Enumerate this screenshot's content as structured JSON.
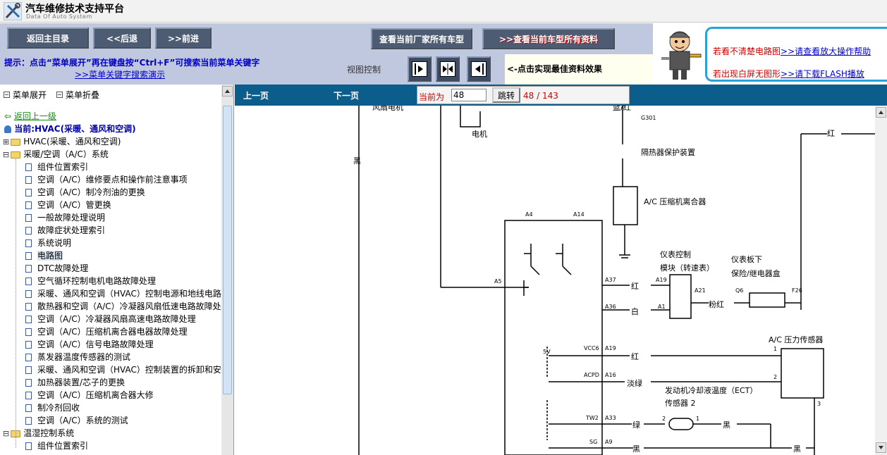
{
  "app": {
    "title": "汽车维修技术支持平台",
    "subtitle": "Data Of Auto System"
  },
  "nav": {
    "home": "返回主目录",
    "back": "<<后退",
    "forward": ">>前进",
    "all_models": "查看当前厂家所有车型",
    "all_data": ">>查看当前车型所有资料"
  },
  "hint": {
    "text": "提示：点击“菜单展开”再在键盘按“Ctrl+F”可搜索当前菜单关键字",
    "link": ">>菜单关键字搜索演示"
  },
  "view_control": {
    "label": "视图控制",
    "best_effect": "<-点击实现最佳资料效果"
  },
  "help": {
    "line1_text": "若看不清楚电路图",
    "line1_link": ">>请查看放大操作帮助",
    "line2_text": "若出现白屏无图形",
    "line2_link": ">>请下载FLASH播放"
  },
  "menu": {
    "expand": "菜单展开",
    "collapse": "菜单折叠"
  },
  "tree": {
    "back_up": "返回上一级",
    "current": "当前:HVAC(采暖、通风和空调)",
    "items": [
      "HVAC(采暖、通风和空调)",
      "采暖/空调（A/C）系统",
      "组件位置索引",
      "空调（A/C）维修要点和操作前注意事项",
      "空调（A/C）制冷剂油的更换",
      "空调（A/C）管更换",
      "一般故障处理说明",
      "故障症状处理索引",
      "系统说明",
      "电路图",
      "DTC故障处理",
      "空气循环控制电机电路故障处理",
      "采暖、通风和空调（HVAC）控制电源和地线电路",
      "散热器和空调（A/C）冷凝器风扇低速电路故障处",
      "空调（A/C）冷凝器风扇高速电路故障处理",
      "空调（A/C）压缩机离合器电器故障处理",
      "空调（A/C）信号电路故障处理",
      "蒸发器温度传感器的测试",
      "采暖、通风和空调（HVAC）控制装置的拆卸和安",
      "加热器装置/芯子的更换",
      "空调（A/C）压缩机离合器大修",
      "制冷剂回收",
      "空调（A/C）系统的测试",
      "温湿控制系统",
      "组件位置索引"
    ]
  },
  "pager": {
    "prev": "上一页",
    "next": "下一页",
    "current_label": "当前为",
    "current_value": "48",
    "jump": "跳转",
    "count": "48 / 143"
  },
  "diagram": {
    "top_left_label": "风扇电机",
    "motor_label": "电机",
    "black1": "黑",
    "blue_red": "蓝/红",
    "g301": "G301",
    "red_top": "红",
    "heat_guard": "隔热器保护装置",
    "ac_clutch": "A/C 压缩机离合器",
    "a4": "A4",
    "a14": "A14",
    "a5": "A5",
    "a37": "A37",
    "a36": "A36",
    "a19": "A19",
    "a16": "A16",
    "a33": "A33",
    "a9": "A9",
    "vcc6": "VCC6",
    "acpd": "ACPD",
    "tw2": "TW2",
    "sg": "SG",
    "v5": "5V",
    "red": "红",
    "white": "白",
    "pink_red": "粉红",
    "light_green": "淡绿",
    "green": "绿",
    "black": "黑",
    "gauge_module": "仪表控制",
    "gauge_module2": "模块（转速表）",
    "a19b": "A19",
    "a1": "A1",
    "a21": "A21",
    "q6": "Q6",
    "f26": "F26",
    "fuse_box": "仪表板下",
    "fuse_box2": "保险/继电器盒",
    "pressure_sensor": "A/C 压力传感器",
    "ect_sensor": "发动机冷却液温度（ECT）",
    "ect_sensor2": "传感器 2",
    "n1": "1",
    "n2": "2",
    "n3": "3"
  },
  "colors": {
    "nav_band": "#c0c8df",
    "pager_bar": "#0b5e8c",
    "accent_red": "#cc0000",
    "link_blue": "#0000cc"
  }
}
